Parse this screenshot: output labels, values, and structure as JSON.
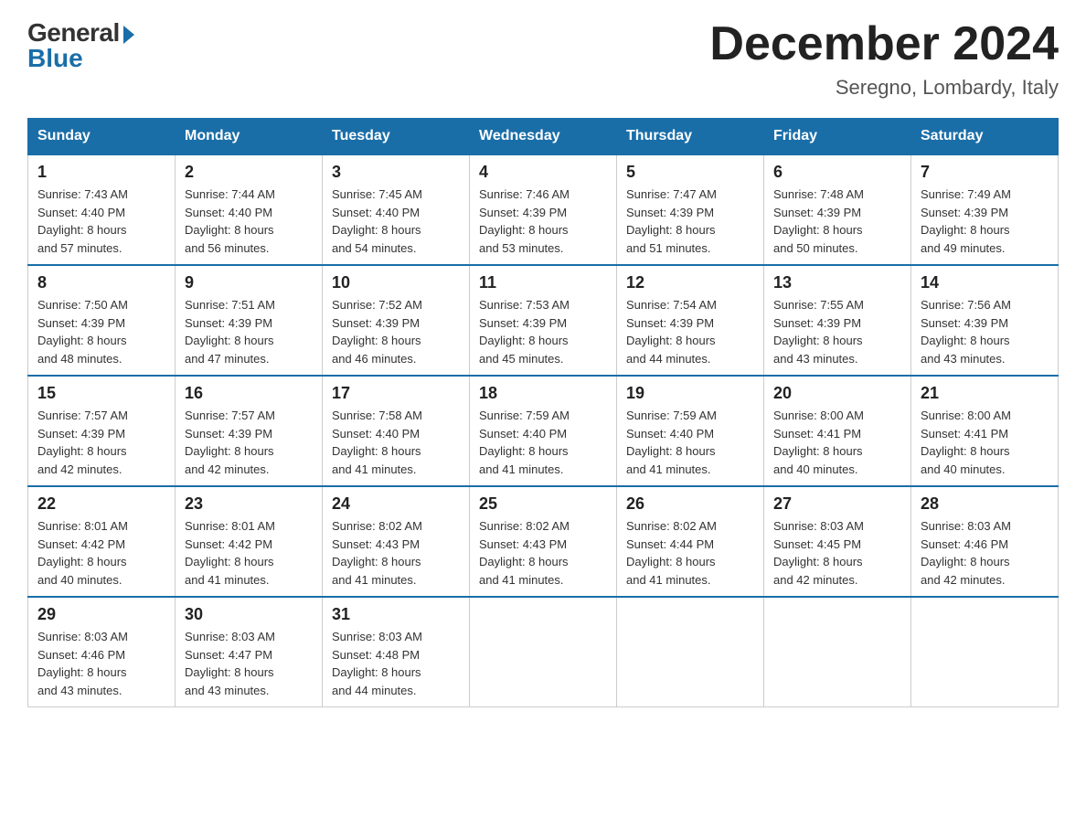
{
  "header": {
    "logo": {
      "general": "General",
      "blue": "Blue"
    },
    "title": "December 2024",
    "location": "Seregno, Lombardy, Italy"
  },
  "days_of_week": [
    "Sunday",
    "Monday",
    "Tuesday",
    "Wednesday",
    "Thursday",
    "Friday",
    "Saturday"
  ],
  "weeks": [
    [
      {
        "day": "1",
        "sunrise": "7:43 AM",
        "sunset": "4:40 PM",
        "daylight": "8 hours and 57 minutes."
      },
      {
        "day": "2",
        "sunrise": "7:44 AM",
        "sunset": "4:40 PM",
        "daylight": "8 hours and 56 minutes."
      },
      {
        "day": "3",
        "sunrise": "7:45 AM",
        "sunset": "4:40 PM",
        "daylight": "8 hours and 54 minutes."
      },
      {
        "day": "4",
        "sunrise": "7:46 AM",
        "sunset": "4:39 PM",
        "daylight": "8 hours and 53 minutes."
      },
      {
        "day": "5",
        "sunrise": "7:47 AM",
        "sunset": "4:39 PM",
        "daylight": "8 hours and 51 minutes."
      },
      {
        "day": "6",
        "sunrise": "7:48 AM",
        "sunset": "4:39 PM",
        "daylight": "8 hours and 50 minutes."
      },
      {
        "day": "7",
        "sunrise": "7:49 AM",
        "sunset": "4:39 PM",
        "daylight": "8 hours and 49 minutes."
      }
    ],
    [
      {
        "day": "8",
        "sunrise": "7:50 AM",
        "sunset": "4:39 PM",
        "daylight": "8 hours and 48 minutes."
      },
      {
        "day": "9",
        "sunrise": "7:51 AM",
        "sunset": "4:39 PM",
        "daylight": "8 hours and 47 minutes."
      },
      {
        "day": "10",
        "sunrise": "7:52 AM",
        "sunset": "4:39 PM",
        "daylight": "8 hours and 46 minutes."
      },
      {
        "day": "11",
        "sunrise": "7:53 AM",
        "sunset": "4:39 PM",
        "daylight": "8 hours and 45 minutes."
      },
      {
        "day": "12",
        "sunrise": "7:54 AM",
        "sunset": "4:39 PM",
        "daylight": "8 hours and 44 minutes."
      },
      {
        "day": "13",
        "sunrise": "7:55 AM",
        "sunset": "4:39 PM",
        "daylight": "8 hours and 43 minutes."
      },
      {
        "day": "14",
        "sunrise": "7:56 AM",
        "sunset": "4:39 PM",
        "daylight": "8 hours and 43 minutes."
      }
    ],
    [
      {
        "day": "15",
        "sunrise": "7:57 AM",
        "sunset": "4:39 PM",
        "daylight": "8 hours and 42 minutes."
      },
      {
        "day": "16",
        "sunrise": "7:57 AM",
        "sunset": "4:39 PM",
        "daylight": "8 hours and 42 minutes."
      },
      {
        "day": "17",
        "sunrise": "7:58 AM",
        "sunset": "4:40 PM",
        "daylight": "8 hours and 41 minutes."
      },
      {
        "day": "18",
        "sunrise": "7:59 AM",
        "sunset": "4:40 PM",
        "daylight": "8 hours and 41 minutes."
      },
      {
        "day": "19",
        "sunrise": "7:59 AM",
        "sunset": "4:40 PM",
        "daylight": "8 hours and 41 minutes."
      },
      {
        "day": "20",
        "sunrise": "8:00 AM",
        "sunset": "4:41 PM",
        "daylight": "8 hours and 40 minutes."
      },
      {
        "day": "21",
        "sunrise": "8:00 AM",
        "sunset": "4:41 PM",
        "daylight": "8 hours and 40 minutes."
      }
    ],
    [
      {
        "day": "22",
        "sunrise": "8:01 AM",
        "sunset": "4:42 PM",
        "daylight": "8 hours and 40 minutes."
      },
      {
        "day": "23",
        "sunrise": "8:01 AM",
        "sunset": "4:42 PM",
        "daylight": "8 hours and 41 minutes."
      },
      {
        "day": "24",
        "sunrise": "8:02 AM",
        "sunset": "4:43 PM",
        "daylight": "8 hours and 41 minutes."
      },
      {
        "day": "25",
        "sunrise": "8:02 AM",
        "sunset": "4:43 PM",
        "daylight": "8 hours and 41 minutes."
      },
      {
        "day": "26",
        "sunrise": "8:02 AM",
        "sunset": "4:44 PM",
        "daylight": "8 hours and 41 minutes."
      },
      {
        "day": "27",
        "sunrise": "8:03 AM",
        "sunset": "4:45 PM",
        "daylight": "8 hours and 42 minutes."
      },
      {
        "day": "28",
        "sunrise": "8:03 AM",
        "sunset": "4:46 PM",
        "daylight": "8 hours and 42 minutes."
      }
    ],
    [
      {
        "day": "29",
        "sunrise": "8:03 AM",
        "sunset": "4:46 PM",
        "daylight": "8 hours and 43 minutes."
      },
      {
        "day": "30",
        "sunrise": "8:03 AM",
        "sunset": "4:47 PM",
        "daylight": "8 hours and 43 minutes."
      },
      {
        "day": "31",
        "sunrise": "8:03 AM",
        "sunset": "4:48 PM",
        "daylight": "8 hours and 44 minutes."
      },
      null,
      null,
      null,
      null
    ]
  ],
  "labels": {
    "sunrise": "Sunrise:",
    "sunset": "Sunset:",
    "daylight": "Daylight:"
  }
}
